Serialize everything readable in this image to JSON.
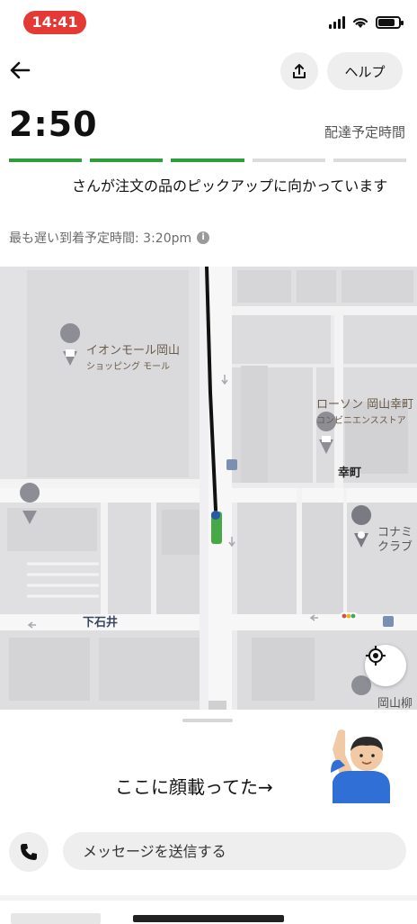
{
  "status_bar": {
    "time": "14:41"
  },
  "header": {
    "help_label": "ヘルプ"
  },
  "eta": {
    "time": "2:50",
    "label": "配達予定時間"
  },
  "progress": {
    "total_steps": 5,
    "completed_steps": 3
  },
  "status": {
    "message": "さんが注文の品のピックアップに向かっています",
    "latest_eta": "最も遅い到着予定時間: 3:20pm"
  },
  "map": {
    "labels": {
      "mall": "イオンモール岡山",
      "mall_sub": "ショッピング モール",
      "lawson": "ローソン 岡山幸町",
      "lawson_sub": "コンビニエンスストア",
      "saiwaicho": "幸町",
      "konami": "コナミ",
      "konami_sub": "クラブ",
      "shimoishii": "下石井",
      "okayama": "岡山柳"
    }
  },
  "sheet": {
    "annotation": "ここに顔載ってた→",
    "message_placeholder": "メッセージを送信する"
  },
  "colors": {
    "progress_done": "#2e9e3a",
    "status_pill": "#e53935",
    "route": "#111111"
  }
}
